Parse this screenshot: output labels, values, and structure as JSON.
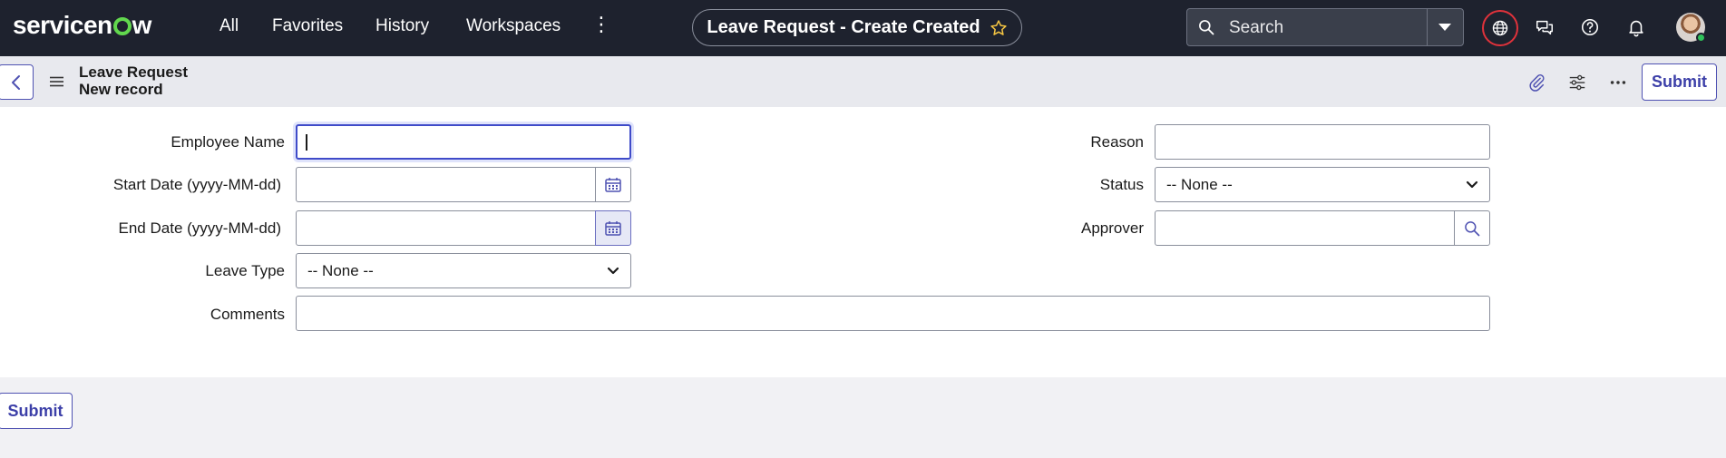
{
  "nav": {
    "logo": {
      "pre": "servicen",
      "post": "w"
    },
    "links": [
      "All",
      "Favorites",
      "History",
      "Workspaces"
    ],
    "title": "Leave Request - Create Created",
    "search_placeholder": "Search"
  },
  "header": {
    "title": "Leave Request",
    "subtitle": "New record",
    "submit_label": "Submit"
  },
  "form": {
    "employee_name": {
      "label": "Employee Name",
      "value": ""
    },
    "start_date": {
      "label": "Start Date (yyyy-MM-dd)",
      "value": ""
    },
    "end_date": {
      "label": "End Date (yyyy-MM-dd)",
      "value": ""
    },
    "leave_type": {
      "label": "Leave Type",
      "selected": "-- None --"
    },
    "comments": {
      "label": "Comments",
      "value": ""
    },
    "reason": {
      "label": "Reason",
      "value": ""
    },
    "status": {
      "label": "Status",
      "selected": "-- None --"
    },
    "approver": {
      "label": "Approver",
      "value": ""
    }
  },
  "footer": {
    "submit_label": "Submit"
  },
  "colors": {
    "nav_bg": "#1e222e",
    "accent": "#4f52b2",
    "logo_green": "#62d84e",
    "globe_ring": "#e0323b"
  },
  "icons": [
    "star-icon",
    "search-icon",
    "dropdown-caret-icon",
    "globe-icon",
    "chat-icon",
    "help-icon",
    "bell-icon",
    "back-icon",
    "menu-icon",
    "paperclip-icon",
    "settings-sliders-icon",
    "more-icon",
    "calendar-icon",
    "magnifier-icon",
    "chevron-down-icon"
  ]
}
